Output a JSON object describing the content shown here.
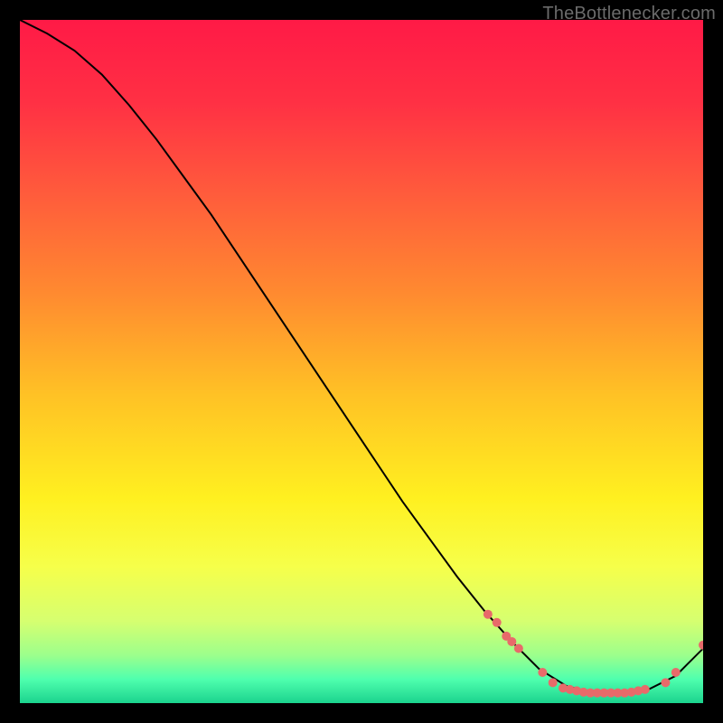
{
  "watermark": "TheBottlenecker.com",
  "chart_data": {
    "type": "line",
    "title": "",
    "xlabel": "",
    "ylabel": "",
    "xlim": [
      0,
      100
    ],
    "ylim": [
      0,
      100
    ],
    "grid": false,
    "legend": false,
    "background_gradient": {
      "stops": [
        {
          "offset": 0.0,
          "color": "#ff1a46"
        },
        {
          "offset": 0.12,
          "color": "#ff3044"
        },
        {
          "offset": 0.25,
          "color": "#ff5a3c"
        },
        {
          "offset": 0.4,
          "color": "#ff8a30"
        },
        {
          "offset": 0.55,
          "color": "#ffc225"
        },
        {
          "offset": 0.7,
          "color": "#fff020"
        },
        {
          "offset": 0.8,
          "color": "#f6ff4a"
        },
        {
          "offset": 0.88,
          "color": "#d6ff70"
        },
        {
          "offset": 0.93,
          "color": "#9cff8c"
        },
        {
          "offset": 0.965,
          "color": "#4fffae"
        },
        {
          "offset": 1.0,
          "color": "#1bd38e"
        }
      ]
    },
    "series": [
      {
        "name": "bottleneck-curve",
        "color": "#000000",
        "width": 2,
        "x": [
          0,
          4,
          8,
          12,
          16,
          20,
          24,
          28,
          32,
          36,
          40,
          44,
          48,
          52,
          56,
          60,
          64,
          68,
          72,
          76,
          80,
          84,
          88,
          92,
          96,
          100
        ],
        "y": [
          100,
          98,
          95.5,
          92,
          87.5,
          82.5,
          77,
          71.5,
          65.5,
          59.5,
          53.5,
          47.5,
          41.5,
          35.5,
          29.5,
          24,
          18.5,
          13.5,
          9,
          5,
          2.5,
          1.5,
          1.5,
          2,
          4,
          8
        ]
      }
    ],
    "scatter_points": {
      "color": "#e86a6a",
      "radius": 5,
      "points": [
        {
          "x": 68.5,
          "y": 13.0
        },
        {
          "x": 69.8,
          "y": 11.8
        },
        {
          "x": 71.2,
          "y": 9.8
        },
        {
          "x": 72.0,
          "y": 9.0
        },
        {
          "x": 73.0,
          "y": 8.0
        },
        {
          "x": 76.5,
          "y": 4.5
        },
        {
          "x": 78.0,
          "y": 3.0
        },
        {
          "x": 79.5,
          "y": 2.2
        },
        {
          "x": 80.5,
          "y": 2.0
        },
        {
          "x": 81.5,
          "y": 1.8
        },
        {
          "x": 82.5,
          "y": 1.6
        },
        {
          "x": 83.5,
          "y": 1.5
        },
        {
          "x": 84.5,
          "y": 1.5
        },
        {
          "x": 85.5,
          "y": 1.5
        },
        {
          "x": 86.5,
          "y": 1.5
        },
        {
          "x": 87.5,
          "y": 1.5
        },
        {
          "x": 88.5,
          "y": 1.5
        },
        {
          "x": 89.5,
          "y": 1.6
        },
        {
          "x": 90.5,
          "y": 1.8
        },
        {
          "x": 91.5,
          "y": 2.0
        },
        {
          "x": 94.5,
          "y": 3.0
        },
        {
          "x": 96.0,
          "y": 4.5
        },
        {
          "x": 100.0,
          "y": 8.5
        }
      ]
    }
  }
}
